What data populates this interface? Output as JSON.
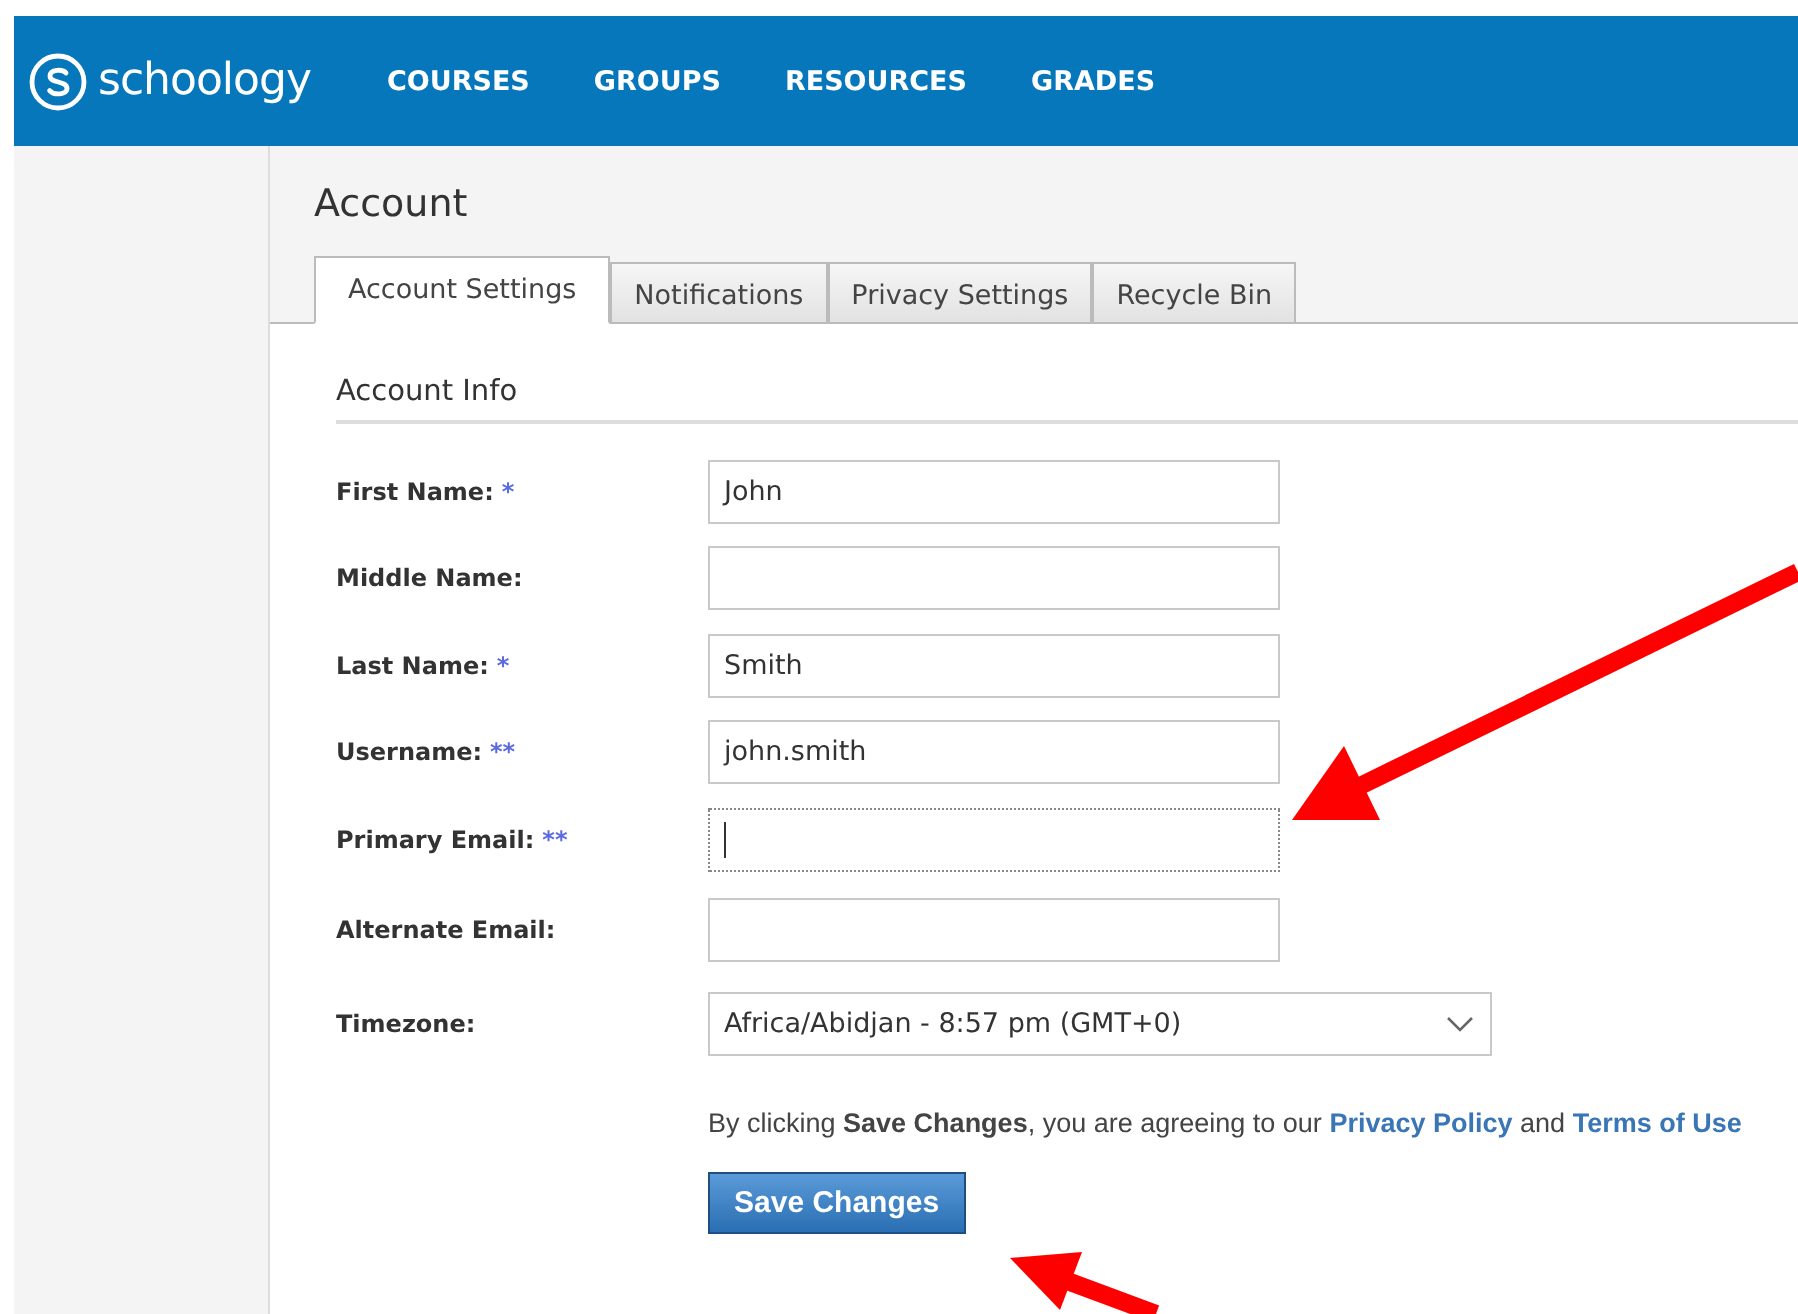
{
  "header": {
    "logo": "schoology",
    "nav": [
      {
        "label": "COURSES"
      },
      {
        "label": "GROUPS"
      },
      {
        "label": "RESOURCES"
      },
      {
        "label": "GRADES"
      }
    ]
  },
  "page": {
    "title": "Account"
  },
  "tabs": [
    {
      "label": "Account Settings",
      "selected": true
    },
    {
      "label": "Notifications",
      "selected": false
    },
    {
      "label": "Privacy Settings",
      "selected": false
    },
    {
      "label": "Recycle Bin",
      "selected": false
    }
  ],
  "section": {
    "title": "Account Info"
  },
  "fields": [
    {
      "kind": "text",
      "label": "First Name:",
      "required": "*",
      "value": "John",
      "focused": false
    },
    {
      "kind": "text",
      "label": "Middle Name:",
      "focused": false
    },
    {
      "kind": "text",
      "label": "Last Name:",
      "required": "*",
      "value": "Smith",
      "focused": false
    },
    {
      "kind": "text",
      "label": "Username:",
      "required": "**",
      "value": "john.smith",
      "focused": false
    },
    {
      "kind": "text",
      "label": "Primary Email:",
      "required": "**",
      "focused": true
    },
    {
      "kind": "text",
      "label": "Alternate Email:",
      "focused": false
    },
    {
      "kind": "select",
      "label": "Timezone:",
      "value": "Africa/Abidjan - 8:57 pm (GMT+0)",
      "focused": false
    }
  ],
  "notice": [
    {
      "kind": "text",
      "text": "By clicking **Save Changes**, you are agreeing to our"
    },
    {
      "kind": "link",
      "text": "Privacy Policy"
    },
    {
      "kind": "text",
      "text": "and"
    },
    {
      "kind": "link",
      "text": "Terms of Use"
    }
  ],
  "save_button": "Save Changes"
}
